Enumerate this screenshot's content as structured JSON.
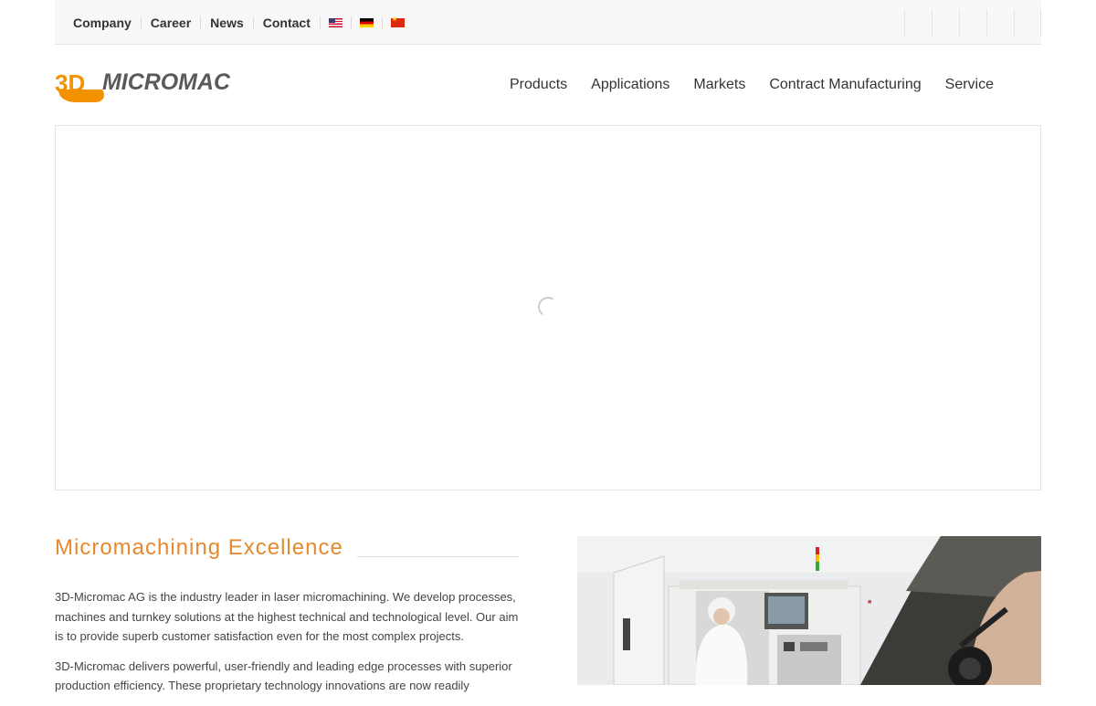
{
  "topnav": {
    "items": [
      "Company",
      "Career",
      "News",
      "Contact"
    ],
    "languages": [
      "english-flag-icon",
      "german-flag-icon",
      "chinese-flag-icon"
    ]
  },
  "social": [
    "social-icon-1",
    "social-icon-2",
    "social-icon-3",
    "social-icon-4",
    "social-icon-5"
  ],
  "logo": {
    "mark": "3D",
    "name": "MICROMAC"
  },
  "mainnav": {
    "items": [
      "Products",
      "Applications",
      "Markets",
      "Contract Manufacturing",
      "Service"
    ]
  },
  "intro": {
    "title": "Micromachining Excellence",
    "paragraphs": [
      "3D-Micromac AG is the industry leader in laser micromachining. We develop processes, machines and turnkey solutions at the highest technical and technological level. Our aim is to provide superb customer satisfaction even for the most complex projects.",
      "3D-Micromac delivers powerful, user-friendly and leading edge processes with superior production efficiency. These proprietary technology innovations are now readily"
    ]
  },
  "colors": {
    "accent": "#e68a2e",
    "logo_orange": "#f39200",
    "logo_gray": "#5a5a5a"
  }
}
